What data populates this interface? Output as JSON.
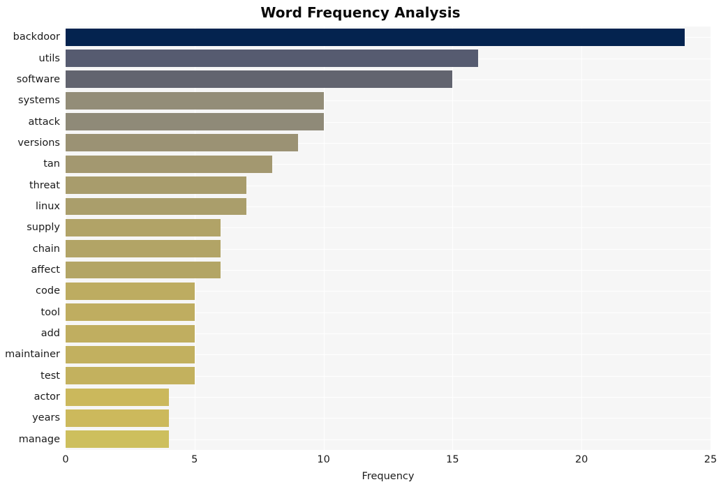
{
  "chart_data": {
    "type": "bar",
    "orientation": "horizontal",
    "title": "Word Frequency Analysis",
    "xlabel": "Frequency",
    "ylabel": "",
    "xlim": [
      0,
      25
    ],
    "xticks": [
      0,
      5,
      10,
      15,
      20,
      25
    ],
    "xtick_labels": [
      "0",
      "5",
      "10",
      "15",
      "20",
      "25"
    ],
    "grid": true,
    "legend": false,
    "categories": [
      "backdoor",
      "utils",
      "software",
      "systems",
      "attack",
      "versions",
      "tan",
      "threat",
      "linux",
      "supply",
      "chain",
      "affect",
      "code",
      "tool",
      "add",
      "maintainer",
      "test",
      "actor",
      "years",
      "manage"
    ],
    "values": [
      24,
      16,
      15,
      10,
      10,
      9,
      8,
      7,
      7,
      6,
      6,
      6,
      5,
      5,
      5,
      5,
      5,
      4,
      4,
      4
    ],
    "bar_colors": [
      "#04234f",
      "#565b70",
      "#62646f",
      "#938d78",
      "#8f8a78",
      "#9b9274",
      "#a39870",
      "#a89c6c",
      "#aa9e6b",
      "#b1a367",
      "#b2a466",
      "#b3a565",
      "#bdac61",
      "#bfad60",
      "#c0ae60",
      "#c2b05f",
      "#c3b15e",
      "#cbb85c",
      "#ccb95c",
      "#cdbf5d"
    ],
    "plot_background": "#f6f6f6",
    "grid_color": "#ffffff",
    "title_color": "#0a0a0a"
  }
}
